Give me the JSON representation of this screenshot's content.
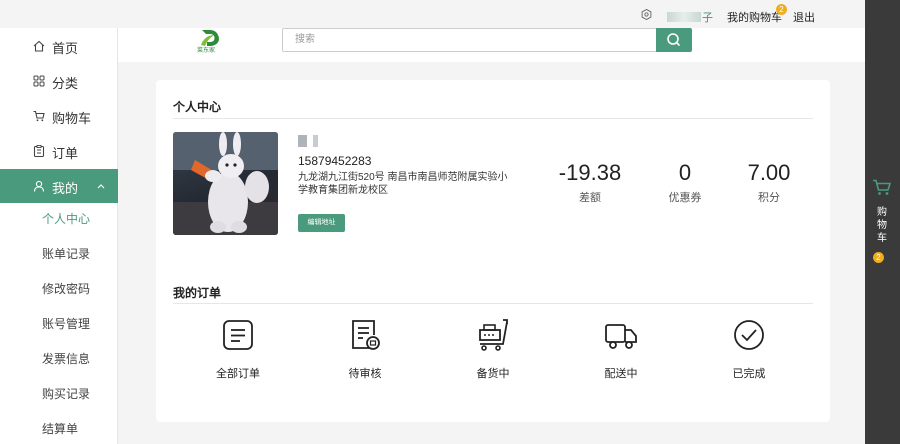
{
  "topbar": {
    "username_suffix": "子",
    "cart_link": "我的购物车",
    "cart_count": "2",
    "logout": "退出"
  },
  "header": {
    "logo_text": "菜东家",
    "search_placeholder": "搜索"
  },
  "sidebar": {
    "items": [
      {
        "label": "首页",
        "icon": "home-icon"
      },
      {
        "label": "分类",
        "icon": "grid-icon"
      },
      {
        "label": "购物车",
        "icon": "cart-icon"
      },
      {
        "label": "订单",
        "icon": "clipboard-icon"
      },
      {
        "label": "我的",
        "icon": "user-icon"
      }
    ],
    "sub_items": [
      "个人中心",
      "账单记录",
      "修改密码",
      "账号管理",
      "发票信息",
      "购买记录",
      "结算单"
    ]
  },
  "rail": {
    "cart_text": "购物车",
    "cart_count": "2"
  },
  "profile": {
    "section_title": "个人中心",
    "phone": "15879452283",
    "address": "九龙湖九江街520号 南昌市南昌师范附属实验小学教育集团新龙校区",
    "edit_button": "编辑地址",
    "stats": [
      {
        "value": "-19.38",
        "label": "差额"
      },
      {
        "value": "0",
        "label": "优惠券"
      },
      {
        "value": "7.00",
        "label": "积分"
      }
    ]
  },
  "orders": {
    "section_title": "我的订单",
    "items": [
      {
        "label": "全部订单",
        "icon": "order-list-icon"
      },
      {
        "label": "待审核",
        "icon": "pending-review-icon"
      },
      {
        "label": "备货中",
        "icon": "stocking-cart-icon"
      },
      {
        "label": "配送中",
        "icon": "delivery-truck-icon"
      },
      {
        "label": "已完成",
        "icon": "check-circle-icon"
      }
    ]
  },
  "colors": {
    "accent": "#4a9a7e",
    "badge": "#f0ad1e",
    "rail": "#3a3a3a"
  }
}
